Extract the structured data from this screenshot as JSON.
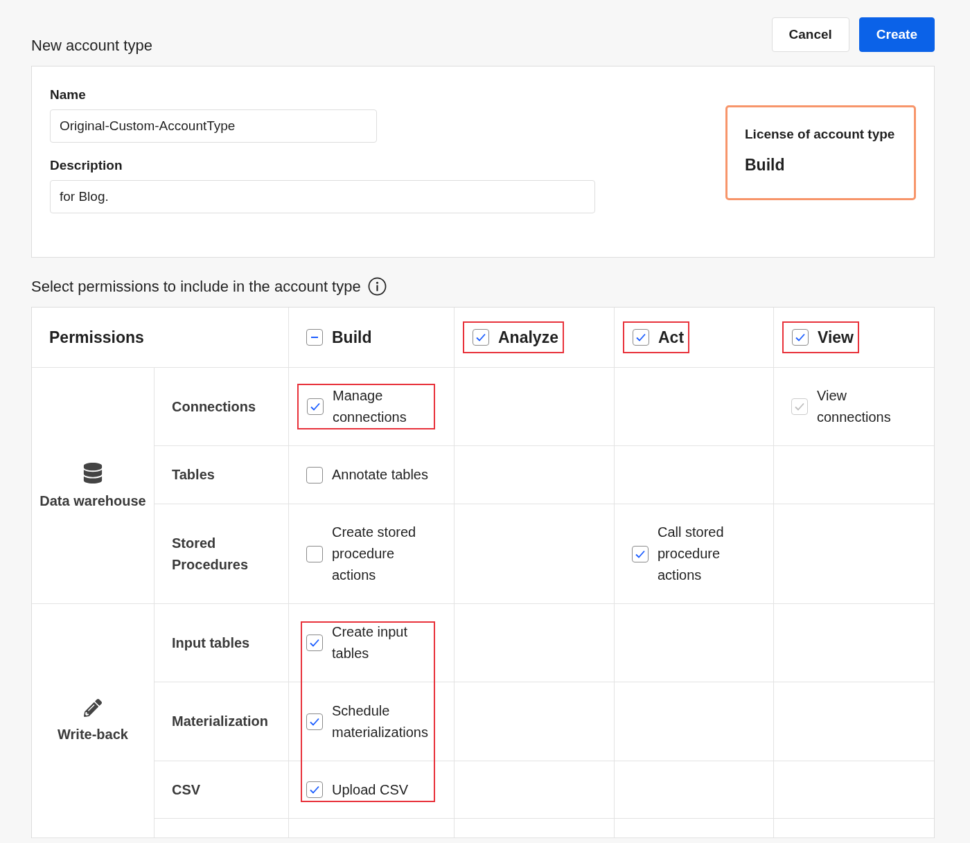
{
  "title": "New account type",
  "buttons": [
    {
      "label": "Cancel",
      "kind": "secondary"
    },
    {
      "label": "Create",
      "kind": "primary"
    }
  ],
  "fields": [
    {
      "label": "Name",
      "value": "Original-Custom-AccountType"
    },
    {
      "label": "Description",
      "value": "for Blog."
    }
  ],
  "license": {
    "label": "License of account type",
    "value": "Build"
  },
  "permissions_title": "Select permissions to include in the account type",
  "table": {
    "heading": "Permissions",
    "columns": [
      {
        "label": "Build",
        "checked": true,
        "indeterminate": true,
        "highlighted": false
      },
      {
        "label": "Analyze",
        "checked": true,
        "indeterminate": false,
        "highlighted": true
      },
      {
        "label": "Act",
        "checked": true,
        "indeterminate": false,
        "highlighted": true
      },
      {
        "label": "View",
        "checked": true,
        "indeterminate": false,
        "highlighted": true
      }
    ],
    "groups": [
      {
        "name": "Data warehouse",
        "rows": [
          {
            "label": "Connections",
            "cells": [
              {
                "label": "Manage connections",
                "checked": true,
                "disabled": false,
                "highlighted": true
              },
              null,
              null,
              {
                "label": "View connections",
                "checked": true,
                "disabled": true,
                "highlighted": false
              }
            ]
          },
          {
            "label": "Tables",
            "cells": [
              {
                "label": "Annotate tables",
                "checked": false,
                "disabled": false,
                "highlighted": false
              },
              null,
              null,
              null
            ]
          },
          {
            "label": "Stored Procedures",
            "cells": [
              {
                "label": "Create stored procedure actions",
                "checked": false,
                "disabled": false,
                "highlighted": false
              },
              null,
              {
                "label": "Call stored procedure actions",
                "checked": true,
                "disabled": false,
                "highlighted": false
              },
              null
            ]
          }
        ]
      },
      {
        "name": "Write-back",
        "rows": [
          {
            "label": "Input tables",
            "cells": [
              {
                "label": "Create input tables",
                "checked": true,
                "disabled": false,
                "highlighted": true
              },
              null,
              null,
              null
            ]
          },
          {
            "label": "Materialization",
            "cells": [
              {
                "label": "Schedule materializations",
                "checked": true,
                "disabled": false,
                "highlighted": true
              },
              null,
              null,
              null
            ]
          },
          {
            "label": "CSV",
            "cells": [
              {
                "label": "Upload CSV",
                "checked": true,
                "disabled": false,
                "highlighted": true
              },
              null,
              null,
              null
            ]
          },
          {
            "cells": [
              null,
              null,
              null,
              null
            ]
          }
        ]
      }
    ]
  }
}
